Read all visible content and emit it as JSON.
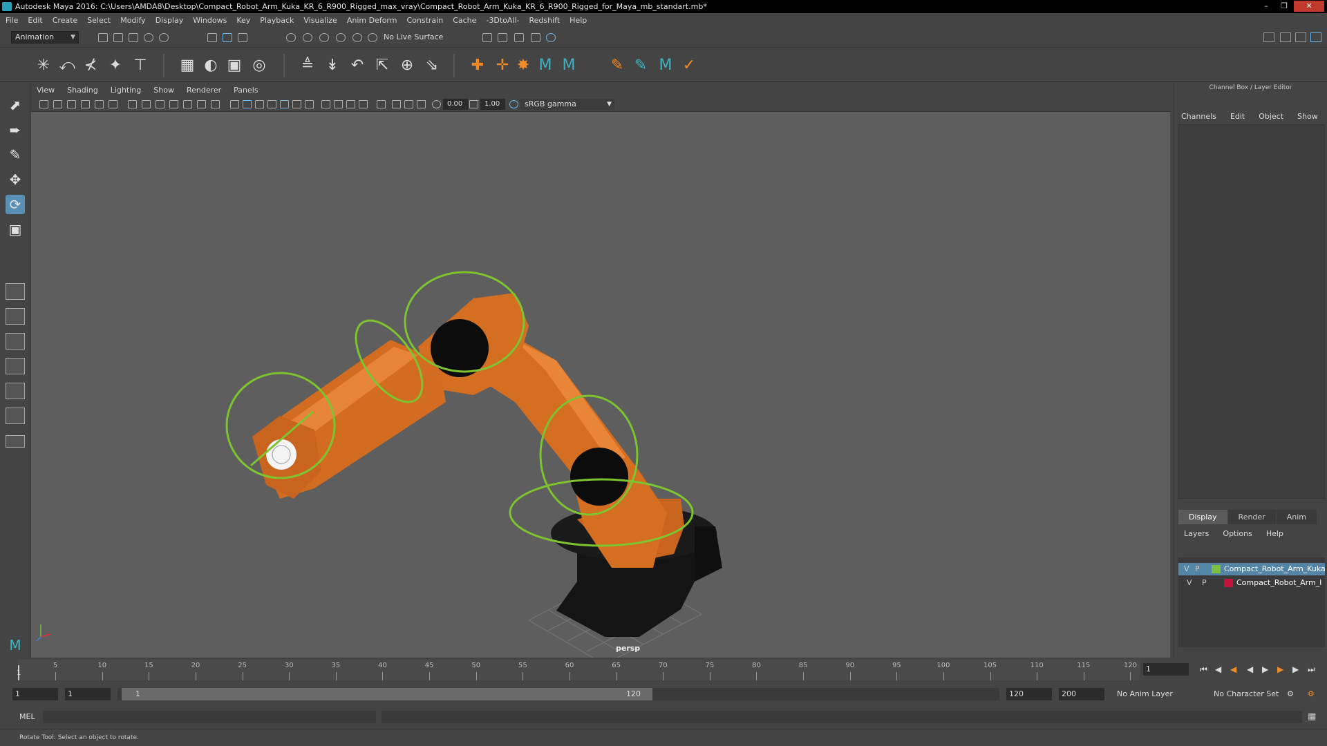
{
  "window": {
    "title": "Autodesk Maya 2016: C:\\Users\\AMDA8\\Desktop\\Compact_Robot_Arm_Kuka_KR_6_R900_Rigged_max_vray\\Compact_Robot_Arm_Kuka_KR_6_R900_Rigged_for_Maya_mb_standart.mb*"
  },
  "menubar": [
    "File",
    "Edit",
    "Create",
    "Select",
    "Modify",
    "Display",
    "Windows",
    "Key",
    "Playback",
    "Visualize",
    "Anim Deform",
    "Constrain",
    "Cache",
    "-3DtoAll-",
    "Redshift",
    "Help"
  ],
  "statusline": {
    "mode": "Animation",
    "live_surface": "No Live Surface"
  },
  "viewport": {
    "menus": [
      "View",
      "Shading",
      "Lighting",
      "Show",
      "Renderer",
      "Panels"
    ],
    "exposure": "0.00",
    "gamma": "1.00",
    "color_space": "sRGB gamma",
    "camera": "persp"
  },
  "channelbox": {
    "title": "Channel Box / Layer Editor",
    "menus": [
      "Channels",
      "Edit",
      "Object",
      "Show"
    ],
    "tabs": [
      "Display",
      "Render",
      "Anim"
    ],
    "layer_menus": [
      "Layers",
      "Options",
      "Help"
    ],
    "layers": [
      {
        "v": "V",
        "p": "P",
        "name": "Compact_Robot_Arm_Kuka",
        "color": "#7fbf3f",
        "selected": true
      },
      {
        "v": "V",
        "p": "P",
        "name": "Compact_Robot_Arm_I",
        "color": "#c0143c",
        "selected": false
      }
    ]
  },
  "timeslider": {
    "ticks": [
      "5",
      "10",
      "15",
      "20",
      "25",
      "30",
      "35",
      "40",
      "45",
      "50",
      "55",
      "60",
      "65",
      "70",
      "75",
      "80",
      "85",
      "90",
      "95",
      "100",
      "105",
      "110",
      "115",
      "120"
    ],
    "start_marker": "1",
    "current_frame": "1"
  },
  "rangeslider": {
    "start": "1",
    "playback_start": "1",
    "range_start": "1",
    "range_end": "120",
    "playback_end": "120",
    "end": "200",
    "anim_layer": "No Anim Layer",
    "character_set": "No Character Set"
  },
  "cmdline": {
    "label": "MEL"
  },
  "helpline": {
    "text": "Rotate Tool: Select an object to rotate."
  }
}
